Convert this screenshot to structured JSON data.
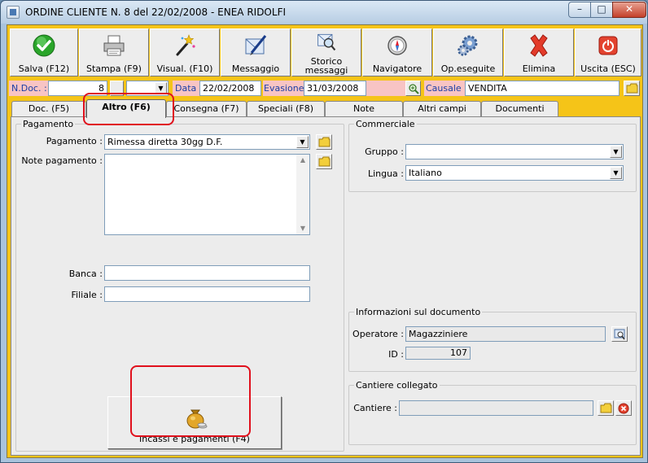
{
  "window": {
    "title": "ORDINE CLIENTE N. 8  del 22/02/2008 - ENEA RIDOLFI",
    "controls": {
      "minimize": "–",
      "maximize": "□",
      "close": "✕"
    }
  },
  "toolbar": {
    "buttons": [
      {
        "label": "Salva (F12)",
        "icon": "check-icon"
      },
      {
        "label": "Stampa (F9)",
        "icon": "printer-icon"
      },
      {
        "label": "Visual. (F10)",
        "icon": "magic-wand-icon"
      },
      {
        "label": "Messaggio",
        "icon": "pen-letter-icon"
      },
      {
        "label_line1": "Storico",
        "label_line2": "messaggi",
        "icon": "search-letter-icon"
      },
      {
        "label": "Navigatore",
        "icon": "compass-icon"
      },
      {
        "label": "Op.eseguite",
        "icon": "gears-icon"
      },
      {
        "label": "Elimina",
        "icon": "delete-x-icon"
      },
      {
        "label": "Uscita (ESC)",
        "icon": "power-icon"
      }
    ]
  },
  "header_fields": {
    "ndoc_label": "N.Doc. :",
    "ndoc_value": "8",
    "data_label": "Data :",
    "data_value": "22/02/2008",
    "evasione_label": "Evasione:",
    "evasione_value": "31/03/2008",
    "causale_label": "Causale :",
    "causale_value": "VENDITA"
  },
  "tabs": [
    {
      "label": "Doc. (F5)"
    },
    {
      "label": "Altro (F6)",
      "active": true
    },
    {
      "label": "Consegna (F7)"
    },
    {
      "label": "Speciali (F8)"
    },
    {
      "label": "Note"
    },
    {
      "label": "Altri campi"
    },
    {
      "label": "Documenti"
    }
  ],
  "pagamento": {
    "group_label": "Pagamento",
    "pagamento_label": "Pagamento :",
    "pagamento_value": "Rimessa diretta 30gg D.F.",
    "note_label": "Note pagamento :",
    "note_value": "",
    "banca_label": "Banca :",
    "banca_value": "",
    "filiale_label": "Filiale :",
    "filiale_value": ""
  },
  "commerciale": {
    "group_label": "Commerciale",
    "gruppo_label": "Gruppo :",
    "gruppo_value": "",
    "lingua_label": "Lingua :",
    "lingua_value": "Italiano"
  },
  "informazioni": {
    "group_label": "Informazioni sul documento",
    "operatore_label": "Operatore :",
    "operatore_value": "Magazziniere",
    "id_label": "ID :",
    "id_value": "107"
  },
  "cantiere": {
    "group_label": "Cantiere collegato",
    "cantiere_label": "Cantiere :",
    "cantiere_value": ""
  },
  "incassi_button": {
    "label": "Incassi e pagamenti (F4)"
  },
  "colors": {
    "client_bg": "#f5c418",
    "label_blue": "#1a3ea6",
    "highlight_red": "#e0101c",
    "pink_field": "#f8c4c4"
  }
}
